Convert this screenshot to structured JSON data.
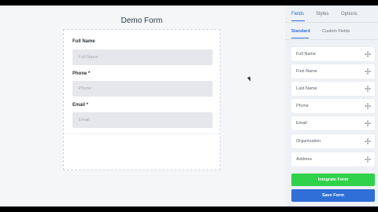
{
  "form": {
    "title": "Demo Form",
    "fields": [
      {
        "label": "Full Name",
        "placeholder": "Full Name"
      },
      {
        "label": "Phone *",
        "placeholder": "Phone"
      },
      {
        "label": "Email *",
        "placeholder": "Email"
      }
    ]
  },
  "sidebar": {
    "tabs": [
      "Fields",
      "Styles",
      "Options"
    ],
    "active_tab": "Fields",
    "subtabs": [
      "Standard",
      "Custom Fields"
    ],
    "active_subtab": "Standard",
    "palette": [
      {
        "label": "Full Name",
        "icon": "move-icon"
      },
      {
        "label": "First Name",
        "icon": "move-icon"
      },
      {
        "label": "Last Name",
        "icon": "move-icon"
      },
      {
        "label": "Phone",
        "icon": "move-icon"
      },
      {
        "label": "Email",
        "icon": "move-icon"
      },
      {
        "label": "Organization",
        "icon": "move-icon"
      },
      {
        "label": "Address",
        "icon": "move-icon"
      }
    ],
    "integrate_label": "Integrate Form",
    "save_label": "Save Form"
  },
  "colors": {
    "accent_blue": "#2f6fd6",
    "accent_green": "#2fd24a"
  }
}
